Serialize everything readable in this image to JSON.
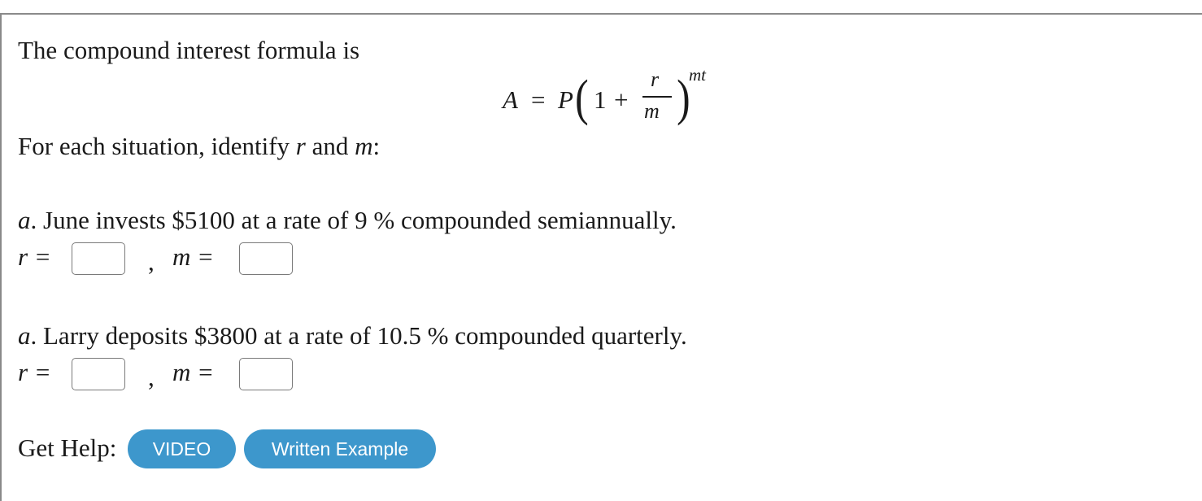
{
  "intro": "The compound interest formula is",
  "formula": {
    "lhs": "A",
    "equals": "=",
    "principal": "P",
    "open_paren": "(",
    "one": "1",
    "plus": "+",
    "numerator": "r",
    "denominator": "m",
    "close_paren": ")",
    "exponent": "mt"
  },
  "instruction": {
    "before": "For each situation, identify ",
    "var_r": "r",
    "middle": " and ",
    "var_m": "m",
    "after": ":"
  },
  "questions": [
    {
      "letter": "a",
      "text_before": ". June invests $5100 at a rate of 9 ",
      "percent": "%",
      "text_after": " compounded semiannually.",
      "r_label": "r =",
      "sep": ",",
      "m_label": "m =",
      "r_value": "",
      "m_value": ""
    },
    {
      "letter": "a",
      "text_before": ". Larry deposits $3800 at a rate of 10.5 ",
      "percent": "%",
      "text_after": " compounded quarterly.",
      "r_label": "r =",
      "sep": ",",
      "m_label": "m =",
      "r_value": "",
      "m_value": ""
    }
  ],
  "help": {
    "label": "Get Help:",
    "video_button": "VIDEO",
    "written_example_button": "Written Example"
  },
  "colors": {
    "button_bg": "#3d97cc",
    "button_text": "#ffffff",
    "border": "#8a8a8a"
  }
}
